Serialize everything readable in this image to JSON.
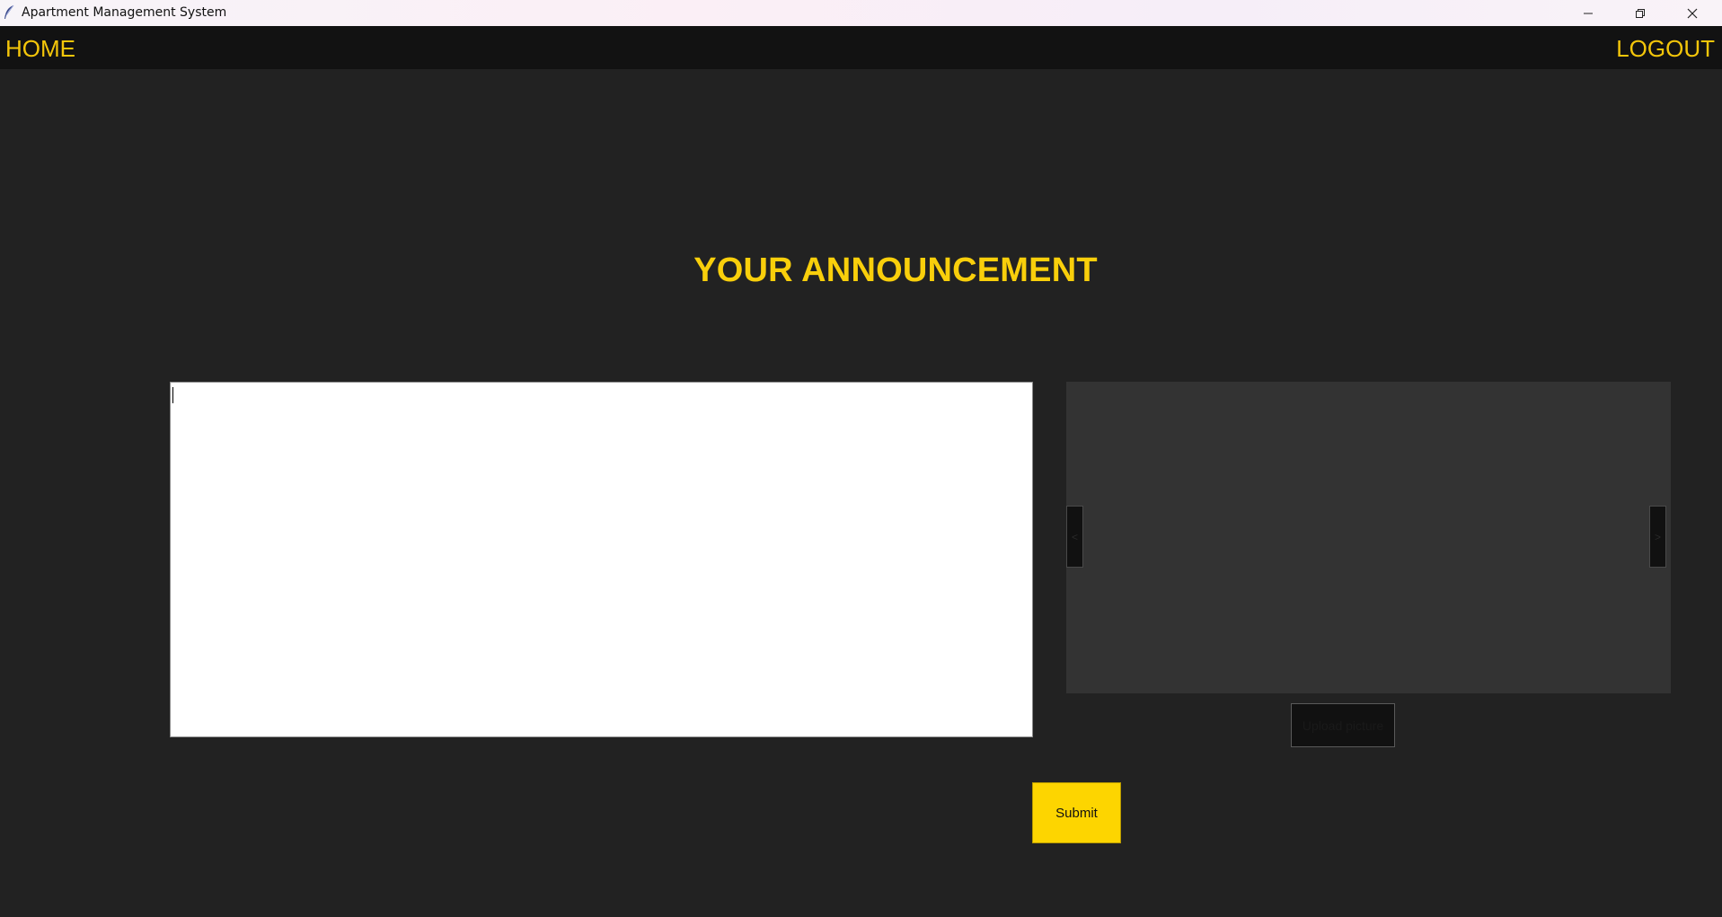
{
  "window": {
    "title": "Apartment Management System",
    "controls": [
      "minimize-icon",
      "restore-icon",
      "close-icon"
    ]
  },
  "nav": {
    "home_label": "HOME",
    "logout_label": "LOGOUT"
  },
  "main": {
    "heading": "YOUR ANNOUNCEMENT",
    "announcement_text": "",
    "picture_panel": {
      "prev_label": "<",
      "next_label": ">"
    },
    "upload_label": "Upload picture",
    "submit_label": "Submit"
  },
  "colors": {
    "background": "#222222",
    "navbar": "#121212",
    "accent": "#f9cf0b",
    "panel": "#333333",
    "submit": "#fdd500"
  }
}
